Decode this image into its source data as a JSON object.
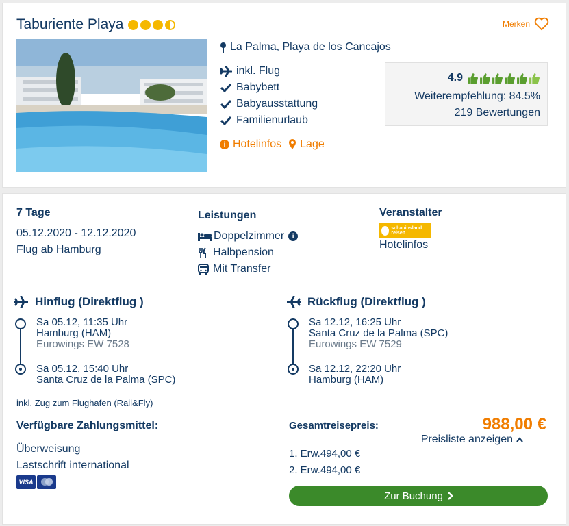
{
  "hotel": {
    "name": "Taburiente Playa",
    "stars": 3.5,
    "merken_label": "Merken",
    "location": "La Palma, Playa de los Cancajos",
    "features": [
      "inkl. Flug",
      "Babybett",
      "Babyausstattung",
      "Familienurlaub"
    ],
    "links": {
      "hotelinfos": "Hotelinfos",
      "lage": "Lage"
    }
  },
  "rating": {
    "score": "4.9",
    "thumbs": 6,
    "recommendation": "Weiterempfehlung: 84.5%",
    "reviews": "219 Bewertungen"
  },
  "trip": {
    "duration": "7 Tage",
    "dates": "05.12.2020 - 12.12.2020",
    "departure": "Flug ab Hamburg"
  },
  "services": {
    "title": "Leistungen",
    "items": [
      "Doppelzimmer",
      "Halbpension",
      "Mit Transfer"
    ]
  },
  "operator": {
    "title": "Veranstalter",
    "logo_text": "schauinsland reisen",
    "link": "Hotelinfos"
  },
  "outbound": {
    "title": "Hinflug (Direktflug )",
    "dep_time": "Sa 05.12, 11:35 Uhr",
    "dep_airport": "Hamburg (HAM)",
    "airline": "Eurowings EW 7528",
    "arr_time": "Sa 05.12, 15:40 Uhr",
    "arr_airport": "Santa Cruz de la Palma (SPC)"
  },
  "return": {
    "title": "Rückflug (Direktflug )",
    "dep_time": "Sa 12.12, 16:25 Uhr",
    "dep_airport": "Santa Cruz de la Palma (SPC)",
    "airline": "Eurowings EW 7529",
    "arr_time": "Sa 12.12, 22:20 Uhr",
    "arr_airport": "Hamburg (HAM)"
  },
  "rail": "inkl. Zug zum Flughafen (Rail&Fly)",
  "payment": {
    "title": "Verfügbare Zahlungsmittel:",
    "methods": [
      "Überweisung",
      "Lastschrift international"
    ],
    "cards": [
      "VISA",
      "Mastercard"
    ]
  },
  "price": {
    "label": "Gesamtreisepreis:",
    "total": "988,00 €",
    "list_link": "Preisliste anzeigen",
    "rows": [
      "1. Erw.494,00 €",
      "2. Erw.494,00 €"
    ]
  },
  "cta": {
    "label": "Zur Buchung"
  },
  "colors": {
    "accent": "#f07d00",
    "navy": "#143a63",
    "green": "#3b8a2a",
    "star": "#f5b800"
  }
}
